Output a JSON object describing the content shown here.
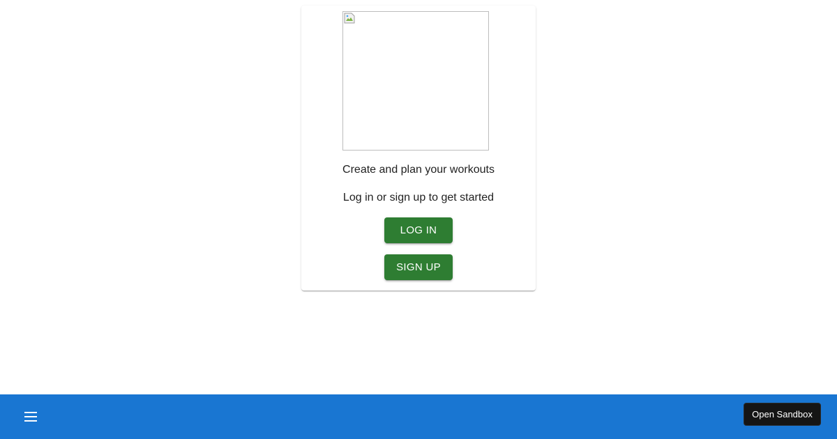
{
  "card": {
    "image_alt": "",
    "tagline": "Create and plan your workouts",
    "subtext": "Log in or sign up to get started",
    "login_label": "LOG IN",
    "signup_label": "SIGN UP"
  },
  "bottom_bar": {
    "menu_icon": "menu-icon",
    "sandbox_label": "Open Sandbox"
  },
  "colors": {
    "primary_button": "#2e7d32",
    "app_bar": "#1976d2",
    "sandbox_button": "#151515"
  }
}
